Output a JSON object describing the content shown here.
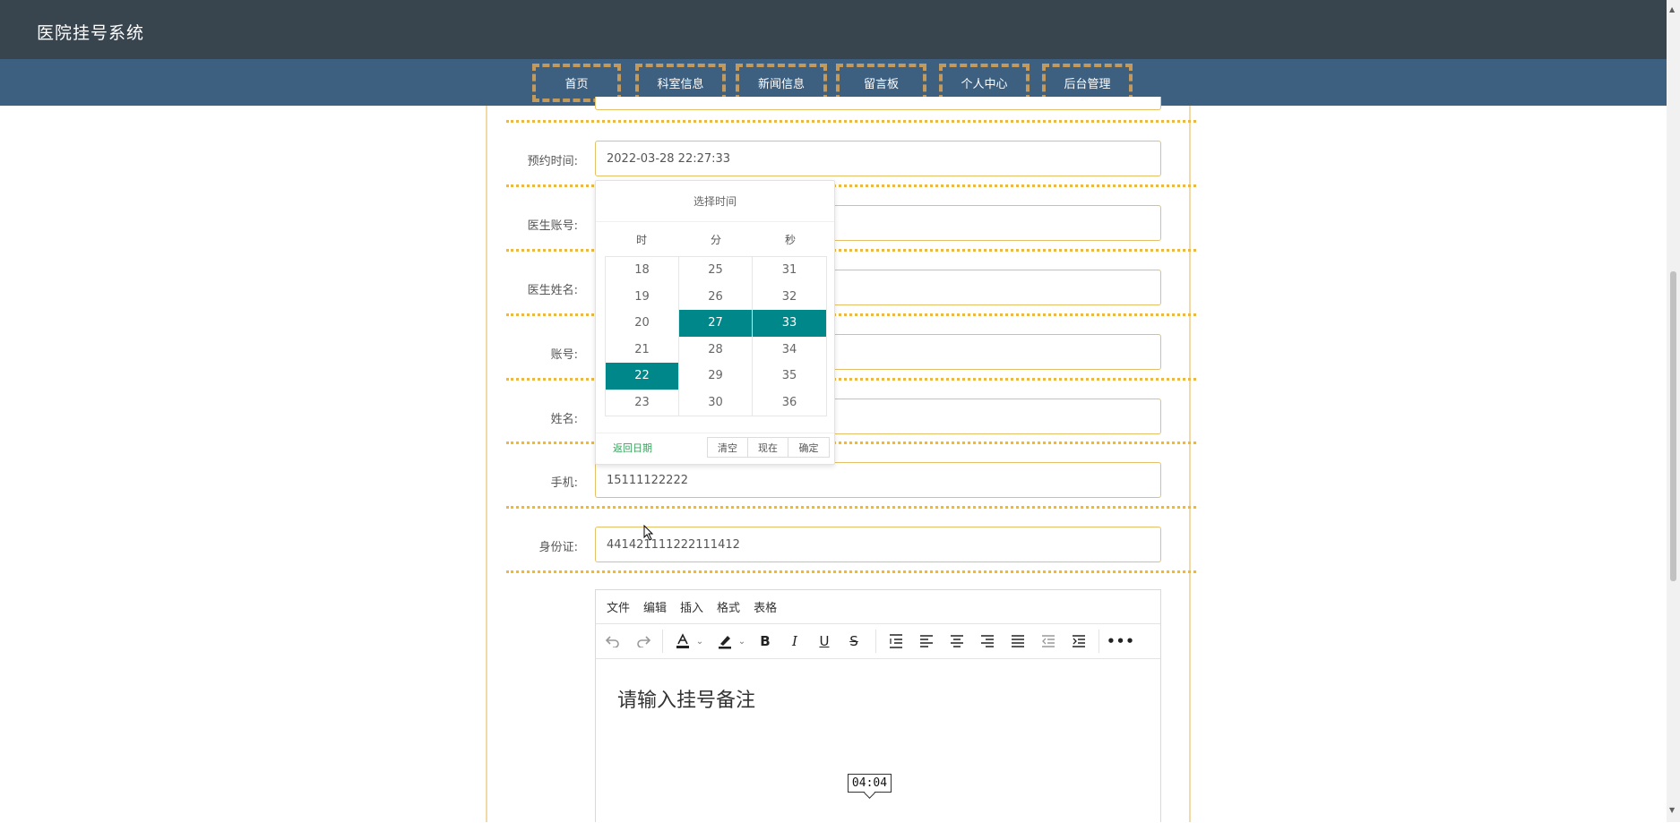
{
  "header": {
    "title": "医院挂号系统"
  },
  "nav": {
    "items": [
      {
        "label": "首页"
      },
      {
        "label": "科室信息"
      },
      {
        "label": "新闻信息"
      },
      {
        "label": "留言板"
      },
      {
        "label": "个人中心"
      },
      {
        "label": "后台管理"
      }
    ]
  },
  "form": {
    "appointment_time": {
      "label": "预约时间:",
      "value": "2022-03-28 22:27:33"
    },
    "doctor_account": {
      "label": "医生账号:",
      "value": ""
    },
    "doctor_name": {
      "label": "医生姓名:",
      "value": ""
    },
    "account": {
      "label": "账号:",
      "value": ""
    },
    "name": {
      "label": "姓名:",
      "value": ""
    },
    "phone": {
      "label": "手机:",
      "value": "15111122222"
    },
    "id_card": {
      "label": "身份证:",
      "value": "441421111222111412"
    }
  },
  "time_picker": {
    "title": "选择时间",
    "headers": {
      "hour": "时",
      "minute": "分",
      "second": "秒"
    },
    "hours": [
      "18",
      "19",
      "20",
      "21",
      "22",
      "23"
    ],
    "minutes": [
      "25",
      "26",
      "27",
      "28",
      "29",
      "30"
    ],
    "seconds": [
      "31",
      "32",
      "33",
      "34",
      "35",
      "36"
    ],
    "selected": {
      "hour": "22",
      "minute": "27",
      "second": "33"
    },
    "back_date": "返回日期",
    "buttons": {
      "clear": "清空",
      "now": "现在",
      "confirm": "确定"
    },
    "accent_color": "#00878a"
  },
  "editor": {
    "menus": [
      "文件",
      "编辑",
      "插入",
      "格式",
      "表格"
    ],
    "placeholder": "请输入挂号备注"
  },
  "overlay": {
    "time": "04:04"
  }
}
